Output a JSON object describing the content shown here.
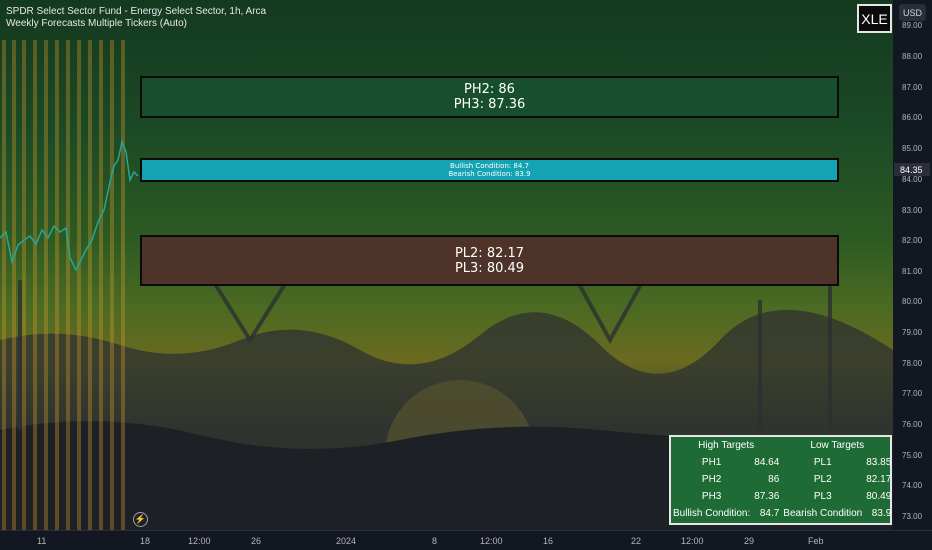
{
  "header": {
    "title": "SPDR Select Sector Fund - Energy Select Sector, 1h, Arca",
    "indicator": "Weekly Forecasts Multiple Tickers (Auto)"
  },
  "ticker_badge": "XLE",
  "currency_button": "USD",
  "current_price": "84.35",
  "zones": {
    "high": {
      "line1": "PH2: 86",
      "line2": "PH3: 87.36"
    },
    "mid": {
      "line1": "Bullish Condition: 84.7",
      "line2": "Bearish Condition: 83.9"
    },
    "low": {
      "line1": "PL2: 82.17",
      "line2": "PL3: 80.49"
    }
  },
  "targets_table": {
    "high_header": "High Targets",
    "low_header": "Low Targets",
    "rows": [
      {
        "hl": "PH1",
        "hv": "84.64",
        "ll": "PL1",
        "lv": "83.85"
      },
      {
        "hl": "PH2",
        "hv": "86",
        "ll": "PL2",
        "lv": "82.17"
      },
      {
        "hl": "PH3",
        "hv": "87.36",
        "ll": "PL3",
        "lv": "80.49"
      }
    ],
    "bull_label": "Bullish Condition:",
    "bull_value": "84.7",
    "bear_label": "Bearish Condition",
    "bear_value": "83.9"
  },
  "price_axis": [
    "89.00",
    "88.00",
    "87.00",
    "86.00",
    "85.00",
    "84.00",
    "83.00",
    "82.00",
    "81.00",
    "80.00",
    "79.00",
    "78.00",
    "77.00",
    "76.00",
    "75.00",
    "74.00",
    "73.00"
  ],
  "time_axis": [
    "11",
    "18",
    "12:00",
    "26",
    "2024",
    "8",
    "12:00",
    "16",
    "22",
    "12:00",
    "29",
    "Feb"
  ],
  "colors": {
    "zone_high": "#174f2c",
    "zone_mid": "#13a3b3",
    "zone_low": "#4d3328",
    "table_bg": "#1e6b35",
    "candle_up": "#26a69a",
    "candle_down": "#ef5350"
  },
  "icons": {
    "bolt": "lightning-icon"
  }
}
